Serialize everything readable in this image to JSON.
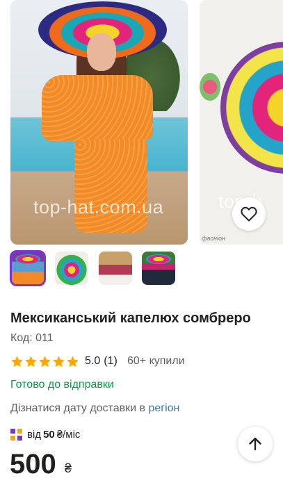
{
  "product": {
    "title": "Мексиканський капелюх сомбреро",
    "code": "Код: 011",
    "rating_value": "5.0",
    "rating_count": "(1)",
    "stars": 5,
    "bought": "60+ купили",
    "availability": "Готово до відправки",
    "delivery_text": "Дізнатися дату доставки в",
    "delivery_link": "регіон",
    "installment_prefix": "від",
    "installment_amount": "50",
    "installment_suffix": "₴/міс",
    "price": "500",
    "currency": "₴"
  },
  "gallery": {
    "watermark_main": "top-hat.com.ua",
    "watermark_second": "top-h",
    "second_caption": "фасніон",
    "thumbnails": [
      {
        "name": "thumb-woman-orange-outfit",
        "active": true
      },
      {
        "name": "thumb-sombrero",
        "active": false
      },
      {
        "name": "thumb-group-photo",
        "active": false
      },
      {
        "name": "thumb-woman-dark-dress",
        "active": false
      }
    ]
  },
  "icons": {
    "favorite": "heart-outline-icon",
    "scroll_top": "arrow-up-icon",
    "installment": "installment-icon",
    "star": "star-icon"
  },
  "colors": {
    "accent_purple": "#7b35d6",
    "availability_green": "#00a046",
    "link_blue": "#3e77aa",
    "star_gold": "#ffa900"
  }
}
